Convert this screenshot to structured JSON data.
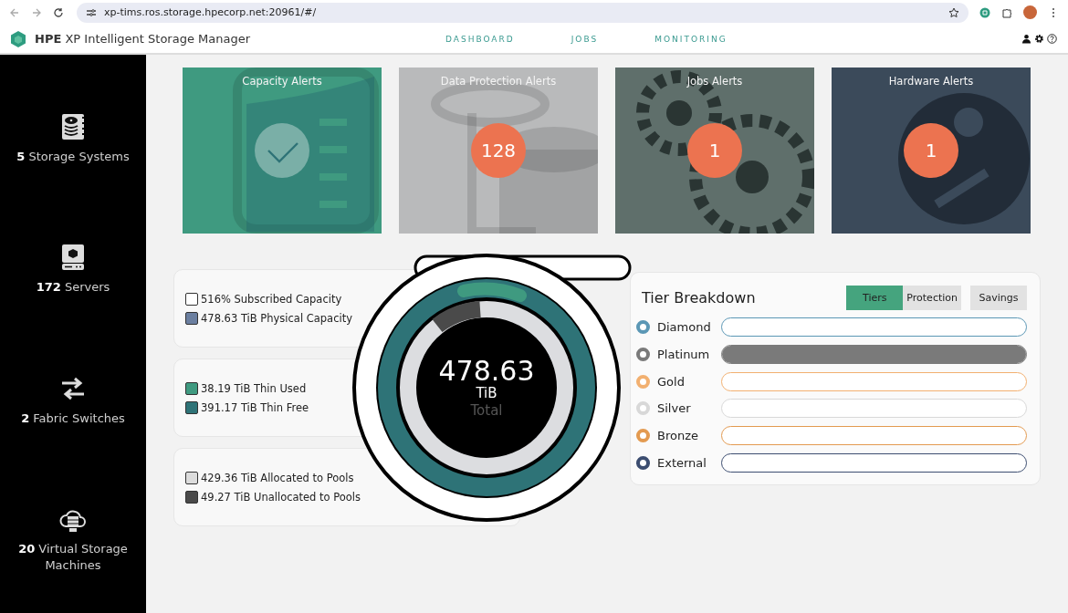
{
  "browser": {
    "url": "xp-tims.ros.storage.hpecorp.net:20961/#/"
  },
  "header": {
    "title": "**HPE** XP Intelligent Storage Manager",
    "nav": [
      {
        "label": "DASHBOARD"
      },
      {
        "label": "JOBS"
      },
      {
        "label": "MONITORING"
      }
    ]
  },
  "sidebar": {
    "items": [
      {
        "count": "5",
        "label": "Storage Systems",
        "kind": "storage"
      },
      {
        "count": "172",
        "label": "Servers",
        "kind": "server"
      },
      {
        "count": "2",
        "label": "Fabric Switches",
        "kind": "switch"
      },
      {
        "count": "20",
        "label": "Virtual Storage Machines",
        "kind": "cloud"
      }
    ]
  },
  "alerts": [
    {
      "title": "Capacity Alerts",
      "kind": "ok",
      "color": "#3f9a80"
    },
    {
      "title": "Data Protection Alerts",
      "kind": "count",
      "count": "128",
      "color": "#b9babb"
    },
    {
      "title": "Jobs Alerts",
      "kind": "count",
      "count": "1",
      "color": "#5f6f6b"
    },
    {
      "title": "Hardware Alerts",
      "kind": "count",
      "count": "1",
      "color": "#3b4a5a"
    }
  ],
  "capacity_groups": [
    {
      "items": [
        {
          "text": "516% Subscribed Capacity",
          "color": "#ffffff"
        },
        {
          "text": "478.63 TiB Physical Capacity",
          "color": "#6b7fa0"
        }
      ]
    },
    {
      "items": [
        {
          "text": "38.19 TiB Thin Used",
          "color": "#3f9a80"
        },
        {
          "text": "391.17 TiB Thin Free",
          "color": "#2e7377"
        }
      ]
    },
    {
      "items": [
        {
          "text": "429.36 TiB Allocated to Pools",
          "color": "#dcdcdc"
        },
        {
          "text": "49.27 TiB Unallocated to Pools",
          "color": "#4a4a4a"
        }
      ]
    }
  ],
  "total": {
    "value": "478.63",
    "unit": "TiB",
    "caption": "Total"
  },
  "tier_breakdown": {
    "title": "Tier Breakdown",
    "tabs": [
      {
        "label": "Tiers",
        "selected": true
      },
      {
        "label": "Protection",
        "selected": false
      },
      {
        "label": "Savings",
        "selected": false
      }
    ],
    "tiers": [
      {
        "name": "Diamond",
        "color": "#5b97b5",
        "level": 0
      },
      {
        "name": "Platinum",
        "color": "#7a7a7a",
        "level": 1
      },
      {
        "name": "Gold",
        "color": "#f2b070",
        "level": 0
      },
      {
        "name": "Silver",
        "color": "#d8d8d8",
        "level": 0
      },
      {
        "name": "Bronze",
        "color": "#e39a50",
        "level": 0
      },
      {
        "name": "External",
        "color": "#3c4d70",
        "level": 0
      }
    ]
  }
}
